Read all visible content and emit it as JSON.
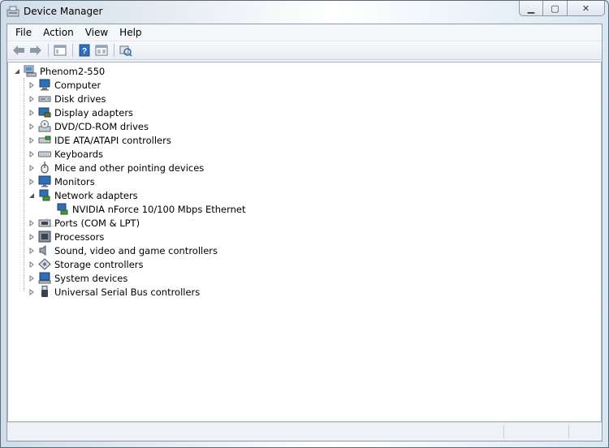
{
  "window": {
    "title": "Device Manager"
  },
  "titlebar": {
    "minimize_glyph": "▁",
    "maximize_glyph": "▢",
    "close_glyph": "✕"
  },
  "menu": {
    "items": [
      "File",
      "Action",
      "View",
      "Help"
    ]
  },
  "toolbar": {
    "buttons": [
      "back-icon",
      "forward-icon",
      "show-hide-console-tree-icon",
      "help-icon",
      "properties-icon",
      "scan-hardware-changes-icon"
    ]
  },
  "tree": {
    "root": {
      "label": "Phenom2-550",
      "expanded": true
    },
    "categories": [
      {
        "label": "Computer",
        "icon": "computer-icon",
        "expanded": false
      },
      {
        "label": "Disk drives",
        "icon": "disk-drive-icon",
        "expanded": false
      },
      {
        "label": "Display adapters",
        "icon": "display-adapter-icon",
        "expanded": false
      },
      {
        "label": "DVD/CD-ROM drives",
        "icon": "dvd-drive-icon",
        "expanded": false
      },
      {
        "label": "IDE ATA/ATAPI controllers",
        "icon": "ide-controller-icon",
        "expanded": false
      },
      {
        "label": "Keyboards",
        "icon": "keyboard-icon",
        "expanded": false
      },
      {
        "label": "Mice and other pointing devices",
        "icon": "mouse-icon",
        "expanded": false
      },
      {
        "label": "Monitors",
        "icon": "monitor-icon",
        "expanded": false
      },
      {
        "label": "Network adapters",
        "icon": "network-adapter-icon",
        "expanded": true,
        "children": [
          "NVIDIA nForce 10/100 Mbps Ethernet"
        ]
      },
      {
        "label": "Ports (COM & LPT)",
        "icon": "port-icon",
        "expanded": false
      },
      {
        "label": "Processors",
        "icon": "processor-icon",
        "expanded": false
      },
      {
        "label": "Sound, video and game controllers",
        "icon": "sound-icon",
        "expanded": false
      },
      {
        "label": "Storage controllers",
        "icon": "storage-controller-icon",
        "expanded": false
      },
      {
        "label": "System devices",
        "icon": "system-device-icon",
        "expanded": false
      },
      {
        "label": "Universal Serial Bus controllers",
        "icon": "usb-icon",
        "expanded": false
      }
    ]
  },
  "colors": {
    "accent": "#2f6fb8",
    "selection": "#cde3f7"
  }
}
